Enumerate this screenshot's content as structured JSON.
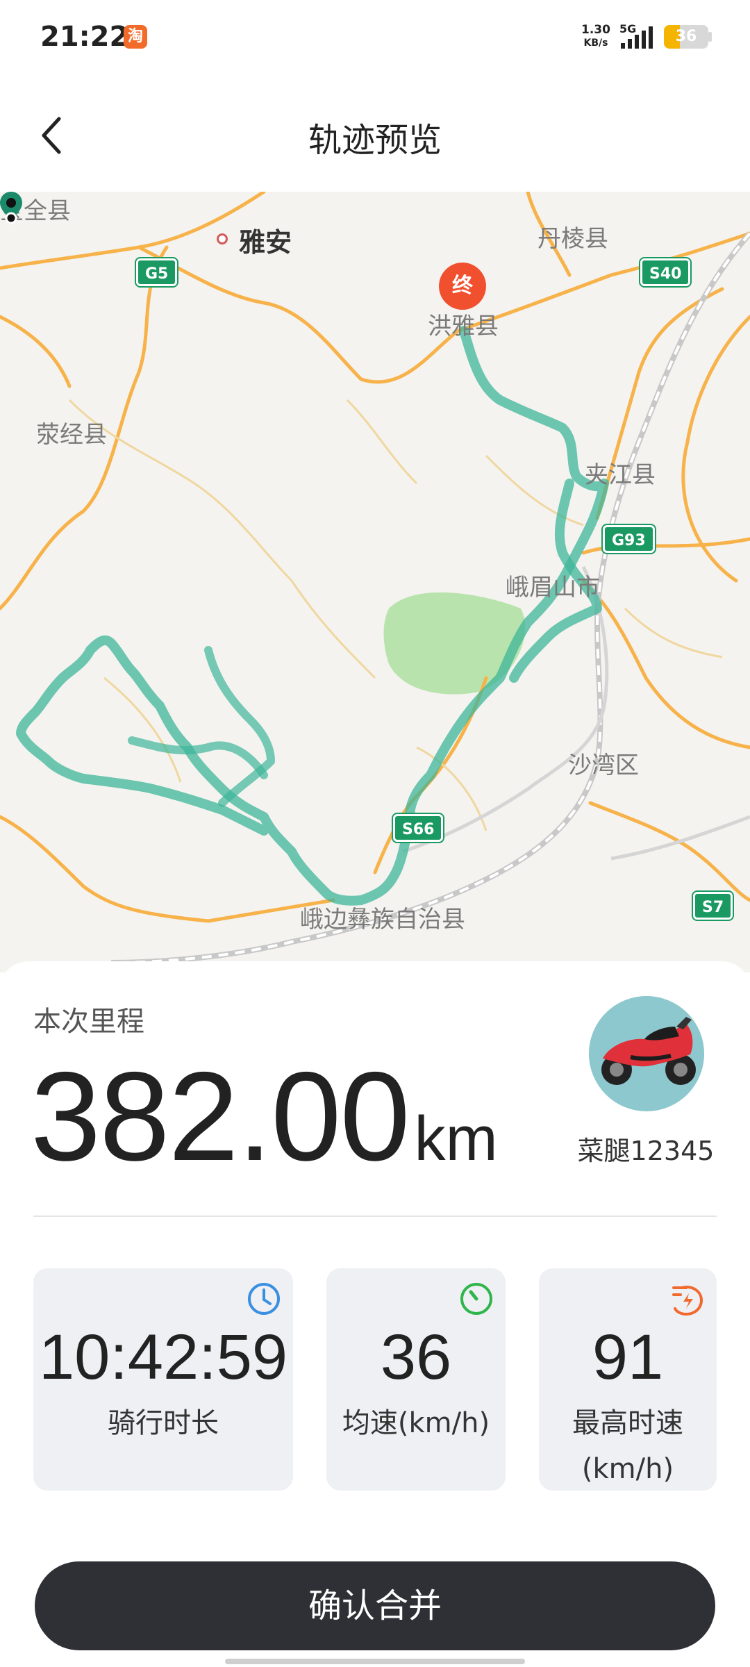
{
  "status_bar": {
    "time": "21:22",
    "app_icon_glyph": "淘",
    "net_speed_value": "1.30",
    "net_speed_unit": "KB/s",
    "network": "5G",
    "battery": "36",
    "battery_percent": 36
  },
  "header": {
    "title": "轨迹预览",
    "back_icon": "chevron-left-icon"
  },
  "map": {
    "labels": {
      "quanxian": "宝全县",
      "yaan": "雅安",
      "danleng": "丹棱县",
      "hongya": "洪雅县",
      "yingjing": "荥经县",
      "jiajiang": "夹江县",
      "emeishan": "峨眉山市",
      "shawan": "沙湾区",
      "ebian": "峨边彝族自治县"
    },
    "roads": {
      "g5": "G5",
      "s40": "S40",
      "g93": "G93",
      "s66": "S66",
      "s7": "S7"
    },
    "end_marker": "终",
    "track_color": "#3fb59a"
  },
  "trip": {
    "distance_label": "本次里程",
    "distance_value": "382.00",
    "distance_unit": "km",
    "username": "菜腿12345"
  },
  "stats": [
    {
      "value": "10:42:59",
      "label": "骑行时长",
      "icon": "clock-icon",
      "color": "#3a8fe0"
    },
    {
      "value": "36",
      "label": "均速(km/h)",
      "icon": "speedometer-icon",
      "color": "#2fb54c"
    },
    {
      "value": "91",
      "label_line1": "最高时速",
      "label_line2": "(km/h)",
      "icon": "fast-speed-icon",
      "color": "#f06a30"
    }
  ],
  "confirm_label": "确认合并"
}
